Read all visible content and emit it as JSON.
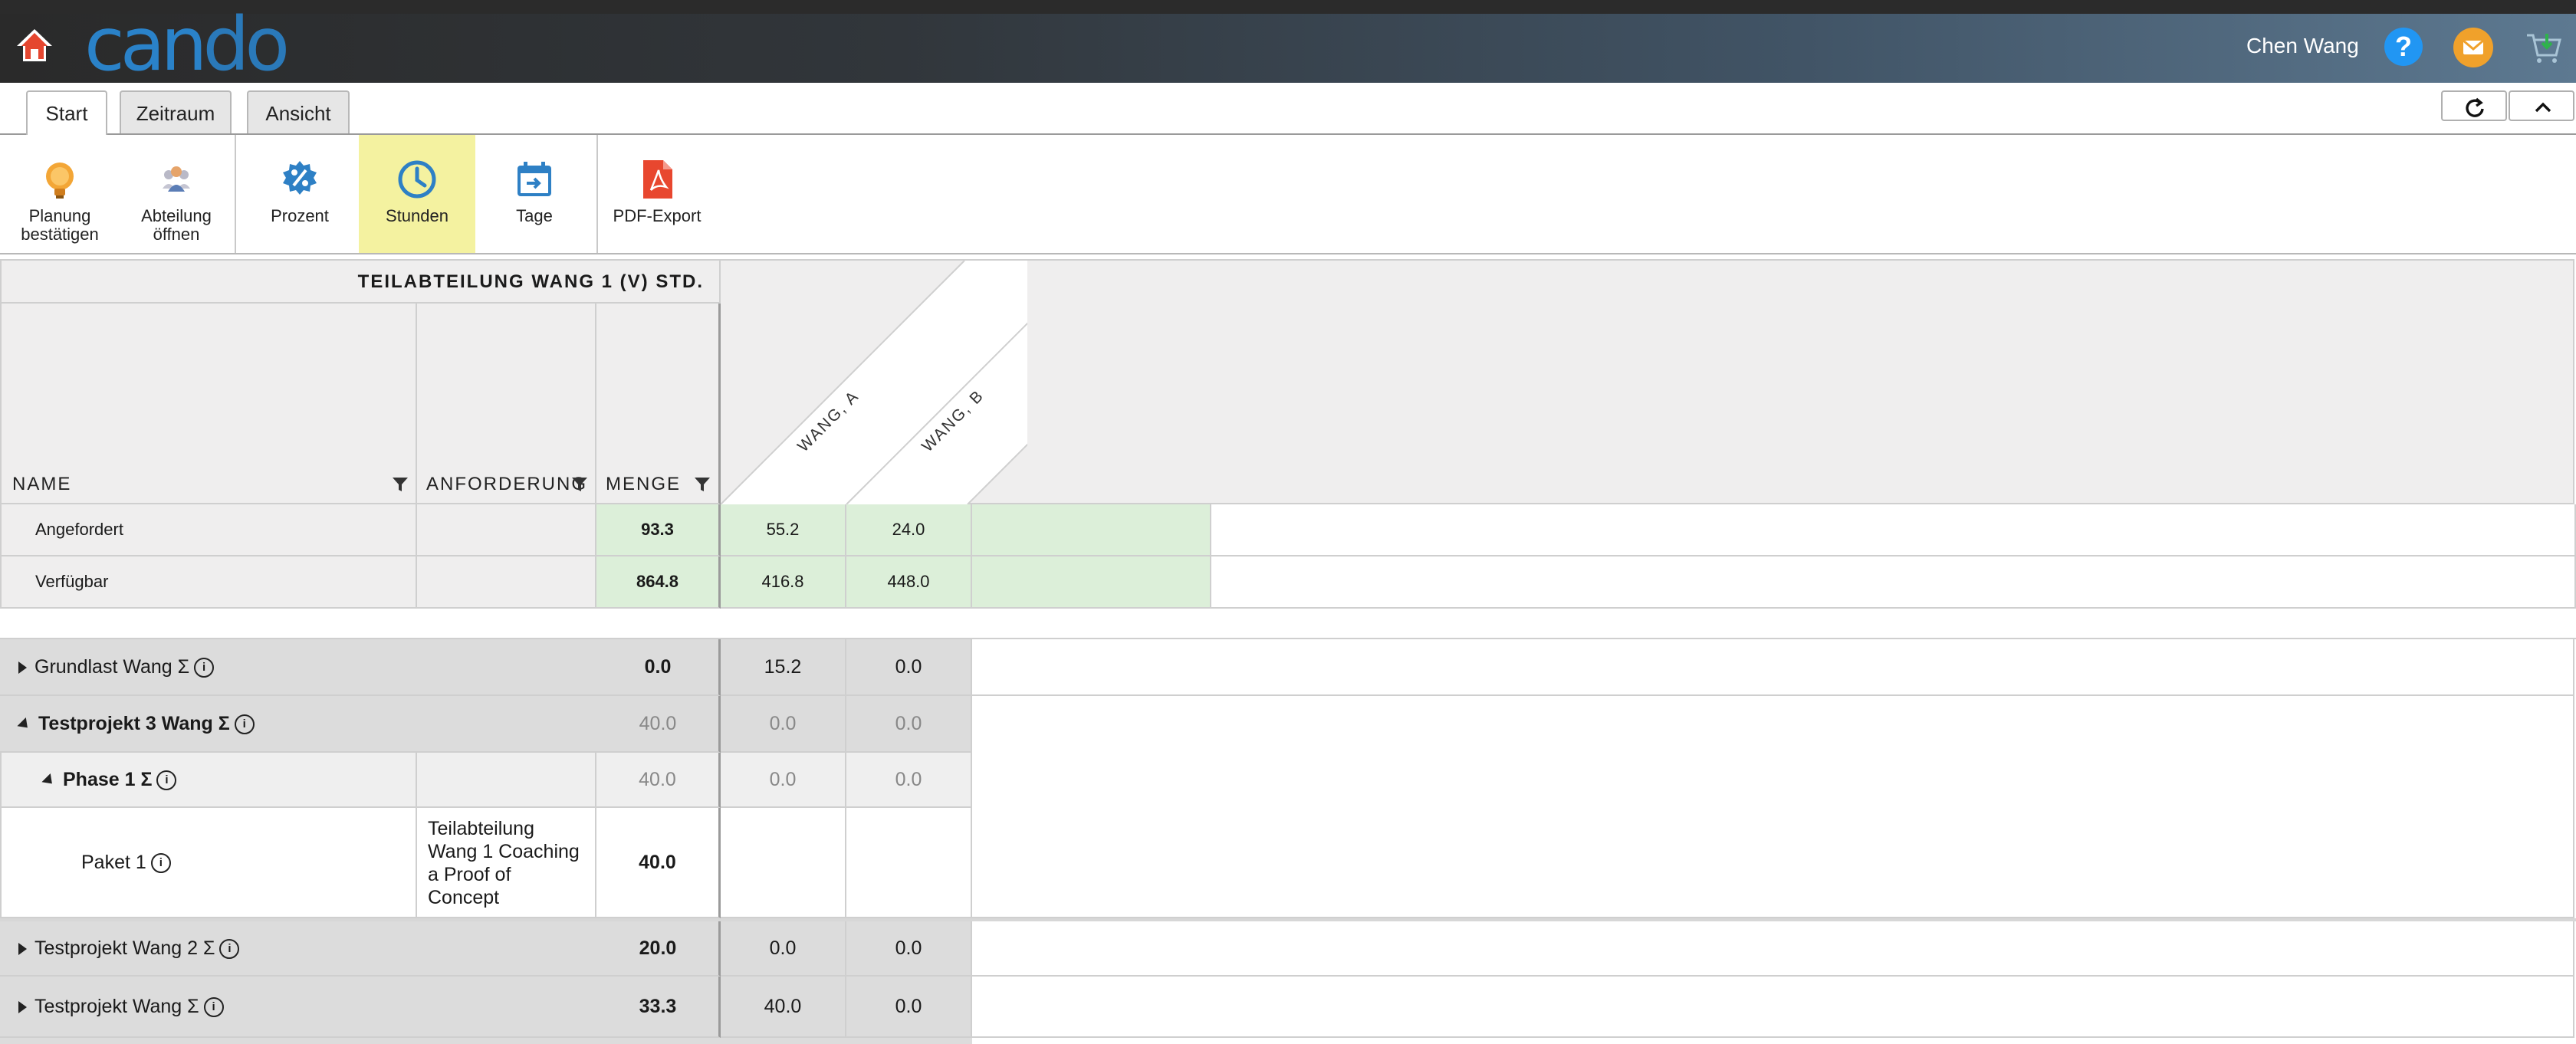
{
  "header": {
    "logo_text": "cando",
    "user_name": "Chen Wang",
    "help_label": "?"
  },
  "tabs": [
    {
      "label": "Start"
    },
    {
      "label": "Zeitraum"
    },
    {
      "label": "Ansicht"
    }
  ],
  "ribbon": {
    "items": [
      {
        "label": "Planung bestätigen",
        "icon": "lightbulb-icon"
      },
      {
        "label": "Abteilung öffnen",
        "icon": "users-icon"
      },
      {
        "label": "Prozent",
        "icon": "percent-gear-icon"
      },
      {
        "label": "Stunden",
        "icon": "clock-icon",
        "selected": true
      },
      {
        "label": "Tage",
        "icon": "calendar-icon"
      },
      {
        "label": "PDF-Export",
        "icon": "pdf-icon"
      }
    ]
  },
  "grid": {
    "title": "TEILABTEILUNG WANG 1 (V) STD.",
    "columns": {
      "name": "NAME",
      "anforderung": "ANFORDERUNG",
      "menge": "MENGE"
    },
    "people": [
      "WANG, A",
      "WANG, B"
    ],
    "summary": [
      {
        "label": "Angefordert",
        "menge": "93.3",
        "a": "55.2",
        "b": "24.0"
      },
      {
        "label": "Verfügbar",
        "menge": "864.8",
        "a": "416.8",
        "b": "448.0"
      }
    ],
    "rows": [
      {
        "label": "Grundlast Wang Σ",
        "menge": "0.0",
        "a": "15.2",
        "b": "0.0"
      },
      {
        "label": "Testprojekt 3 Wang Σ",
        "menge": "40.0",
        "a": "0.0",
        "b": "0.0"
      },
      {
        "label": "Phase 1 Σ",
        "menge": "40.0",
        "a": "0.0",
        "b": "0.0"
      },
      {
        "label": "Paket 1",
        "anforderung": "Teilabteilung Wang 1 Coaching a Proof of Concept",
        "menge": "40.0"
      },
      {
        "label": "Testprojekt Wang 2 Σ",
        "menge": "20.0",
        "a": "0.0",
        "b": "0.0"
      },
      {
        "label": "Testprojekt Wang Σ",
        "menge": "33.3",
        "a": "40.0",
        "b": "0.0"
      }
    ]
  },
  "info_glyph": "i",
  "colors": {
    "accent": "#2196f3",
    "selected_ribbon": "#f4f2a0",
    "green_cell": "#dcefd9"
  }
}
